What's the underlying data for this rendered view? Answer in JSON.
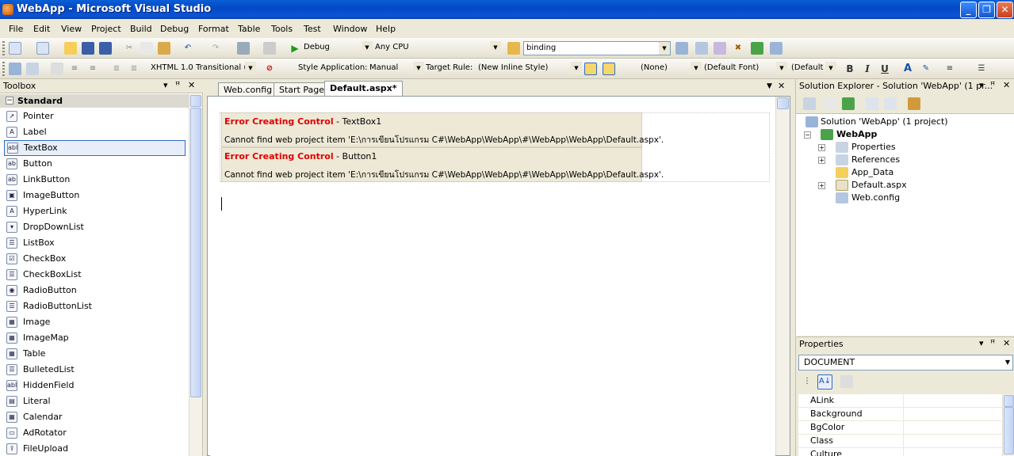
{
  "window": {
    "title": "WebApp - Microsoft Visual Studio"
  },
  "menu": [
    "File",
    "Edit",
    "View",
    "Project",
    "Build",
    "Debug",
    "Format",
    "Table",
    "Tools",
    "Test",
    "Window",
    "Help"
  ],
  "toolbar1": {
    "config": "Debug",
    "platform": "Any CPU",
    "find": "binding"
  },
  "toolbar2": {
    "doctype": "XHTML 1.0 Transitional (",
    "style_application_label": "Style Application:",
    "style_application_value": "Manual",
    "target_rule_label": "Target Rule:",
    "target_rule_value": "(New Inline Style)",
    "block_format": "(None)",
    "font": "(Default Font)",
    "font_size": "(Default",
    "bold": "B",
    "italic": "I",
    "underline": "U"
  },
  "toolbox": {
    "title": "Toolbox",
    "category": "Standard",
    "items": [
      "Pointer",
      "Label",
      "TextBox",
      "Button",
      "LinkButton",
      "ImageButton",
      "HyperLink",
      "DropDownList",
      "ListBox",
      "CheckBox",
      "CheckBoxList",
      "RadioButton",
      "RadioButtonList",
      "Image",
      "ImageMap",
      "Table",
      "BulletedList",
      "HiddenField",
      "Literal",
      "Calendar",
      "AdRotator",
      "FileUpload"
    ],
    "selected": "TextBox"
  },
  "editor": {
    "tabs": [
      "Web.config",
      "Start Page",
      "Default.aspx*"
    ],
    "active_tab": "Default.aspx*",
    "errors": [
      {
        "title": "Error Creating Control",
        "control": " - TextBox1",
        "message": "Cannot find web project item 'E:\\การเขียนโปรแกรม C#\\WebApp\\WebApp\\#\\WebApp\\WebApp\\Default.aspx'."
      },
      {
        "title": "Error Creating Control",
        "control": " - Button1",
        "message": "Cannot find web project item 'E:\\การเขียนโปรแกรม C#\\WebApp\\WebApp\\#\\WebApp\\WebApp\\Default.aspx'."
      }
    ]
  },
  "solution_explorer": {
    "title": "Solution Explorer - Solution 'WebApp' (1 pr...",
    "solution": "Solution 'WebApp' (1 project)",
    "project": "WebApp",
    "items": [
      "Properties",
      "References",
      "App_Data",
      "Default.aspx",
      "Web.config"
    ]
  },
  "properties": {
    "title": "Properties",
    "object": "DOCUMENT",
    "rows": [
      "ALink",
      "Background",
      "BgColor",
      "Class",
      "Culture"
    ]
  },
  "colors": {
    "titlebar": "#0348c4",
    "error_title": "#e00000",
    "chrome": "#ece9d8"
  }
}
